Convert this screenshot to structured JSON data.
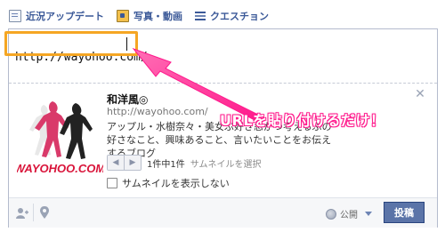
{
  "tabs": [
    {
      "label": "近況アップデート",
      "icon": "status-icon"
    },
    {
      "label": "写真・動画",
      "icon": "photo-icon"
    },
    {
      "label": "クエスチョン",
      "icon": "question-icon"
    }
  ],
  "composer": {
    "url_value": "http://wayohoo.com/"
  },
  "preview": {
    "title": "和洋風◎",
    "url": "http://wayohoo.com/",
    "description": "アップル・水樹奈々・美女ぷ好き忍がつ考えるぶの好さなこと、興味あること、言いたいことをお伝えするブログ",
    "thumb_logo_text": "WAYOHOO.COM",
    "pager_count": "1件中1件",
    "select_thumbnail": "サムネイルを選択",
    "no_thumbnail_label": "サムネイルを表示しない"
  },
  "footer": {
    "privacy_label": "公開",
    "post_label": "投稿"
  },
  "annotation": {
    "text": "URLを貼り付けるだけ！",
    "color": "#ff1a8c",
    "highlight_color": "#f5a623"
  },
  "colors": {
    "link": "#3b5998",
    "post_button": "#5b74a8"
  }
}
